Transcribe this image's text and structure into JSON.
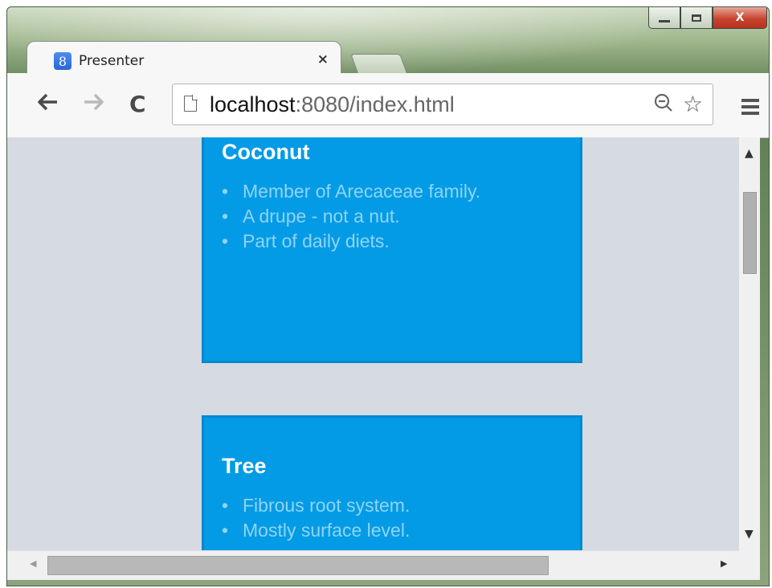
{
  "window": {
    "controls": {
      "minimize": "",
      "maximize": "",
      "close": "X"
    }
  },
  "tabs": [
    {
      "title": "Presenter",
      "favicon": "8",
      "close": "×"
    }
  ],
  "toolbar": {
    "back_icon": "🡐",
    "forward_icon": "🡒",
    "reload_icon": "C",
    "url_host": "localhost",
    "url_rest": ":8080/index.html",
    "zoom_icon": "🔍",
    "star_icon": "☆"
  },
  "cards": [
    {
      "title": "Coconut",
      "items": [
        "Member of Arecaceae family.",
        "A drupe - not a nut.",
        "Part of daily diets."
      ]
    },
    {
      "title": "Tree",
      "items": [
        "Fibrous root system.",
        "Mostly surface level."
      ]
    }
  ],
  "scrollbars": {
    "up_arrow": "▲",
    "down_arrow": "▼",
    "left_arrow": "◀",
    "right_arrow": "▶"
  }
}
